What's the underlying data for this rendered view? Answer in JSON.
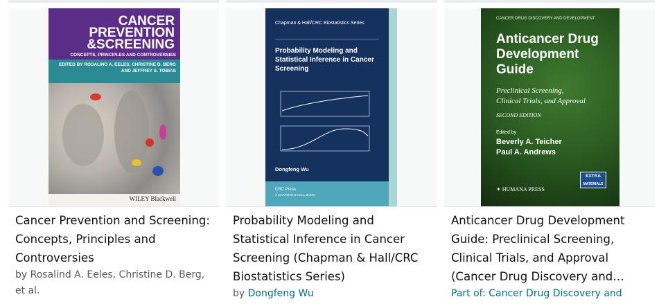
{
  "books": [
    {
      "title": "Cancer Prevention and Screening: Concepts, Principles and Controversies",
      "author_prefix": "by ",
      "author": "Rosalind A. Eeles, Christine D. Berg, et al.",
      "cover": {
        "line1": "CANCER",
        "line2": "PREVENTION",
        "line3": "&SCREENING",
        "subtitle": "CONCEPTS, PRINCIPLES AND CONTROVERSIES",
        "edited_by": "EDITED BY ROSALIND A. EELES, CHRISTINE D. BERG AND JEFFREY S. TOBIAS",
        "publisher": "WILEY Blackwell"
      }
    },
    {
      "title": "Probability Modeling and Statistical Inference in Cancer Screening (Chapman & Hall/CRC Biostatistics Series)",
      "author_prefix": "by ",
      "author": "Dongfeng Wu",
      "cover": {
        "series": "Chapman & Hall/CRC Biostatistics Series",
        "title": "Probability Modeling and Statistical Inference in Cancer Screening",
        "author": "Dongfeng Wu",
        "press": "CRC Press",
        "press_sub": "A CHAPMAN & HALL BOOK"
      }
    },
    {
      "title": "Anticancer Drug Development Guide: Preclinical Screening, Clinical Trials, and Approval (Cancer Drug Discovery and…",
      "series_prefix": "Part of: ",
      "series": "Cancer Drug Discovery and",
      "cover": {
        "series": "CANCER DRUG DISCOVERY AND DEVELOPMENT",
        "title": "Anticancer Drug Development Guide",
        "subtitle1": "Preclinical Screening,",
        "subtitle2": "Clinical Trials, and Approval",
        "edition": "SECOND EDITION",
        "edited_by": "Edited by",
        "editor1": "Beverly A. Teicher",
        "editor2": "Paul A. Andrews",
        "press": "HUMANA PRESS",
        "badge1": "EXTRA",
        "badge2": "MATERIALS"
      }
    }
  ]
}
